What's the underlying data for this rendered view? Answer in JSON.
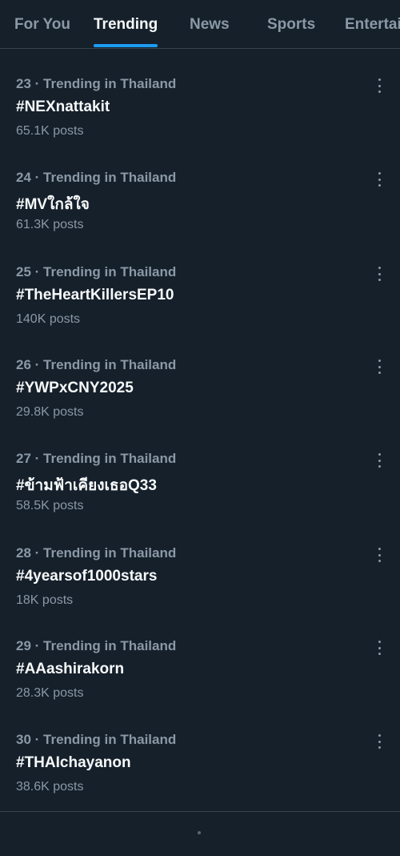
{
  "tabs": [
    "For You",
    "Trending",
    "News",
    "Sports",
    "Entertai"
  ],
  "active_tab": "Trending",
  "colors": {
    "background": "#15202b",
    "accent": "#1d9bf0",
    "secondary_text": "#8b98a5",
    "primary_text": "#f7f9f9"
  },
  "trends": [
    {
      "meta": "23 · Trending in Thailand",
      "tag": "#NEXnattakit",
      "count": "65.1K posts",
      "menu_icon": "more-vertical-icon"
    },
    {
      "meta": "24 · Trending in Thailand",
      "tag": "#MVใกล้ใจ",
      "count": "61.3K posts",
      "menu_icon": "more-vertical-icon"
    },
    {
      "meta": "25 · Trending in Thailand",
      "tag": "#TheHeartKillersEP10",
      "count": "140K posts",
      "menu_icon": "more-vertical-icon"
    },
    {
      "meta": "26 · Trending in Thailand",
      "tag": "#YWPxCNY2025",
      "count": "29.8K posts",
      "menu_icon": "more-vertical-icon"
    },
    {
      "meta": "27 · Trending in Thailand",
      "tag": "#ข้ามฟ้าเคียงเธอQ33",
      "count": "58.5K posts",
      "menu_icon": "more-vertical-icon"
    },
    {
      "meta": "28 · Trending in Thailand",
      "tag": "#4yearsof1000stars",
      "count": "18K posts",
      "menu_icon": "more-vertical-icon"
    },
    {
      "meta": "29 · Trending in Thailand",
      "tag": "#AAashirakorn",
      "count": "28.3K posts",
      "menu_icon": "more-vertical-icon"
    },
    {
      "meta": "30 · Trending in Thailand",
      "tag": "#THAIchayanon",
      "count": "38.6K posts",
      "menu_icon": "more-vertical-icon"
    }
  ]
}
